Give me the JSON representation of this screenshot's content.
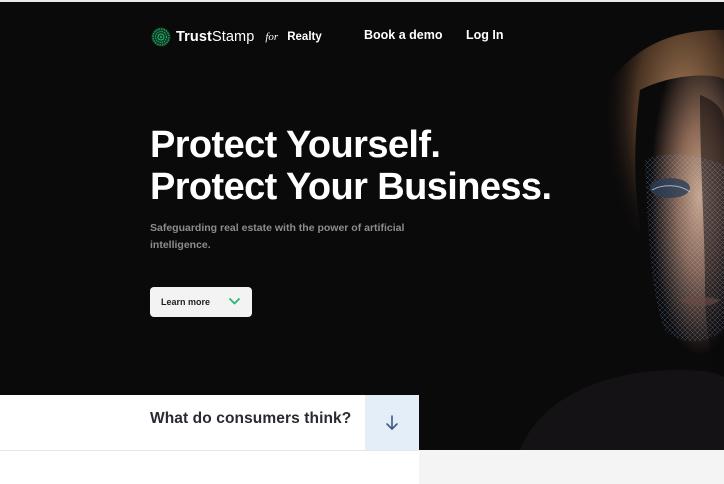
{
  "brand": {
    "name_bold": "Trust",
    "name_light": "Stamp",
    "for": "for",
    "vertical": "Realty",
    "logo_icon": "truststamp-logo-icon"
  },
  "nav": {
    "book_demo": "Book a demo",
    "login": "Log In"
  },
  "hero": {
    "headline_line1": "Protect Yourself.",
    "headline_line2": "Protect Your Business.",
    "subtitle": "Safeguarding real estate with the power of artificial intelligence.",
    "learn_more": "Learn more",
    "learn_more_icon": "chevron-down-icon"
  },
  "consumers": {
    "question": "What do consumers think?",
    "arrow_icon": "arrow-down-icon"
  },
  "colors": {
    "hero_bg": "#0b0a0b",
    "accent_green": "#2bb673",
    "scroll_button_bg": "#e4eef9"
  }
}
